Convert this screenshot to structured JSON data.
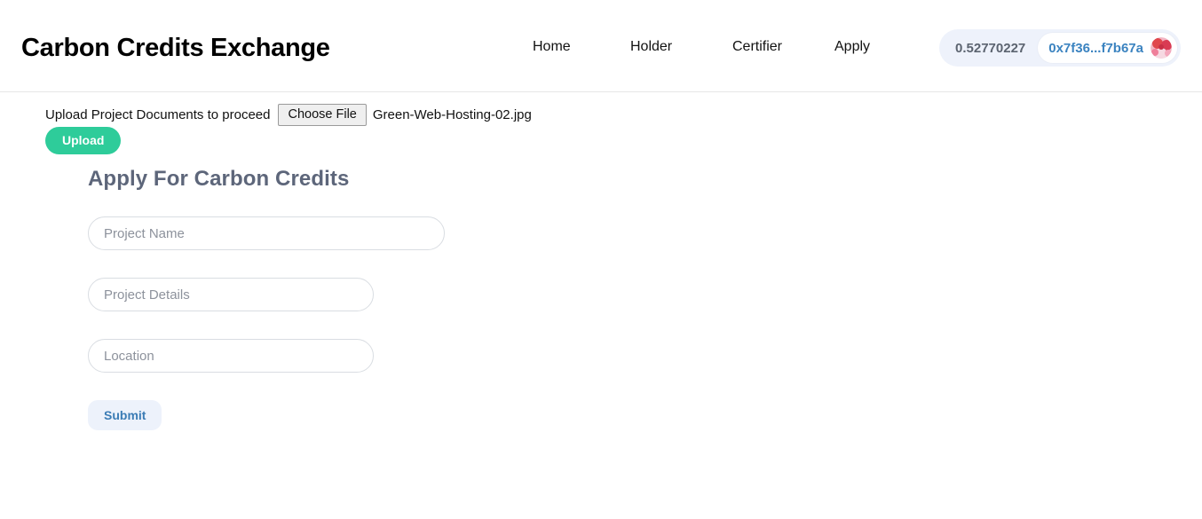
{
  "header": {
    "brand": "Carbon Credits Exchange",
    "nav": [
      {
        "label": "Home",
        "name": "nav-link-home"
      },
      {
        "label": "Holder",
        "name": "nav-link-holder"
      },
      {
        "label": "Certifier",
        "name": "nav-link-certifier"
      },
      {
        "label": "Apply",
        "name": "nav-link-apply"
      }
    ],
    "wallet": {
      "balance": "0.52770227",
      "address": "0x7f36...f7b67a",
      "avatar_icon": "wallet-identicon-avatar",
      "pill_background": "#eef2fb",
      "address_color": "#3b83c0",
      "balance_color": "#5c6470"
    }
  },
  "upload": {
    "label": "Upload Project Documents to proceed",
    "choose_file_label": "Choose File",
    "file_name": "Green-Web-Hosting-02.jpg",
    "upload_button_label": "Upload",
    "upload_button_color": "#2ecc9a"
  },
  "form": {
    "title": "Apply For Carbon Credits",
    "title_color": "#5d667a",
    "fields": [
      {
        "name": "project-name-input",
        "placeholder": "Project Name",
        "value": "",
        "width": "wide"
      },
      {
        "name": "project-details-input",
        "placeholder": "Project Details",
        "value": "",
        "width": "narrow"
      },
      {
        "name": "location-input",
        "placeholder": "Location",
        "value": "",
        "width": "narrow"
      }
    ],
    "submit_label": "Submit",
    "submit_color": "#3b7cb5",
    "submit_background": "#edf2fb"
  }
}
